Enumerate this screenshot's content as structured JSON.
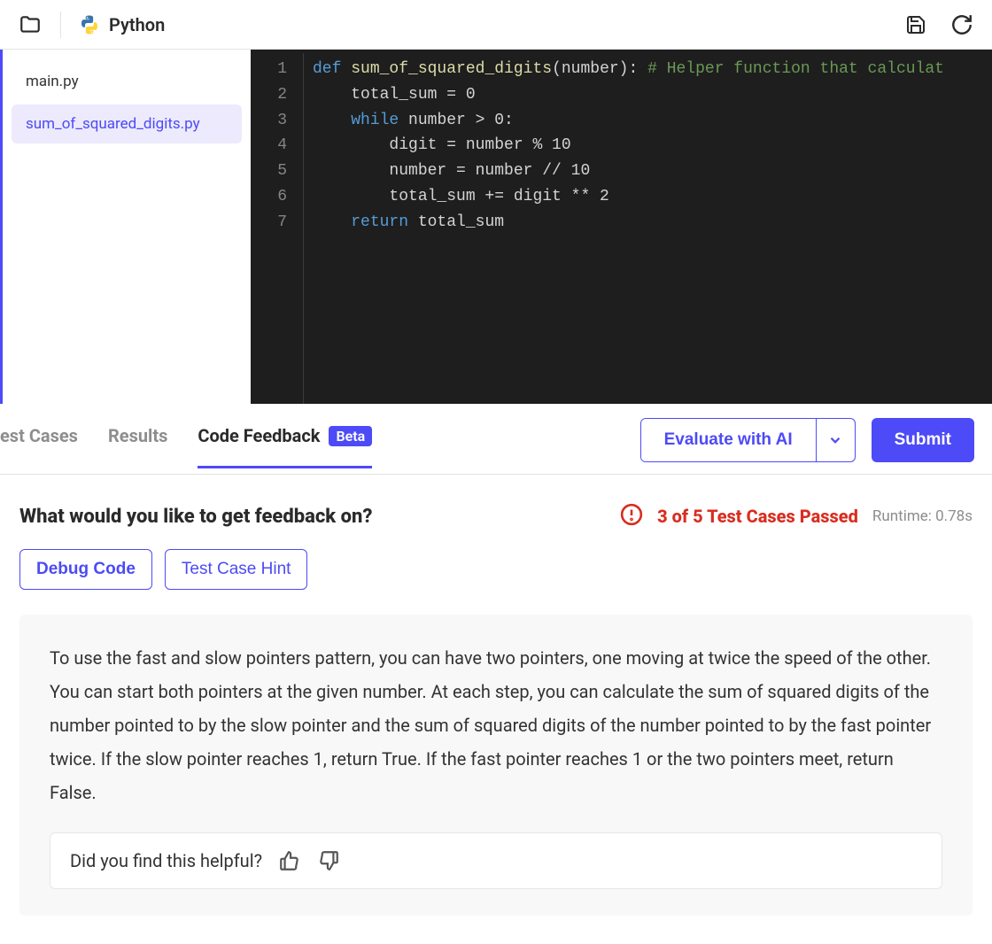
{
  "header": {
    "language": "Python"
  },
  "sidebar": {
    "files": [
      {
        "name": "main.py",
        "active": false
      },
      {
        "name": "sum_of_squared_digits.py",
        "active": true
      }
    ]
  },
  "editor": {
    "lines": [
      1,
      2,
      3,
      4,
      5,
      6,
      7
    ],
    "code_html": "<span class=\"tok-kw\">def</span> <span class=\"tok-fn\">sum_of_squared_digits</span>(number): <span class=\"tok-cm\"># Helper function that calculat</span>\n    total_sum = 0\n    <span class=\"tok-kw\">while</span> number &gt; 0:\n        digit = number % 10\n        number = number // 10\n        total_sum += digit ** 2\n    <span class=\"tok-kw\">return</span> total_sum"
  },
  "tabs": {
    "items": [
      {
        "label": "est Cases",
        "active": false
      },
      {
        "label": "Results",
        "active": false
      },
      {
        "label": "Code Feedback",
        "active": true,
        "badge": "Beta"
      }
    ],
    "evaluate_label": "Evaluate with AI",
    "submit_label": "Submit"
  },
  "feedback": {
    "title": "What would you like to get feedback on?",
    "status_text": "3 of 5 Test Cases Passed",
    "runtime": "Runtime: 0.78s",
    "actions": [
      {
        "label": "Debug Code"
      },
      {
        "label": "Test Case Hint"
      }
    ],
    "card_text": "To use the fast and slow pointers pattern, you can have two pointers, one moving at twice the speed of the other. You can start both pointers at the given number. At each step, you can calculate the sum of squared digits of the number pointed to by the slow pointer and the sum of squared digits of the number pointed to by the fast pointer twice. If the slow pointer reaches 1, return True. If the fast pointer reaches 1 or the two pointers meet, return False.",
    "helpful_prompt": "Did you find this helpful?"
  }
}
